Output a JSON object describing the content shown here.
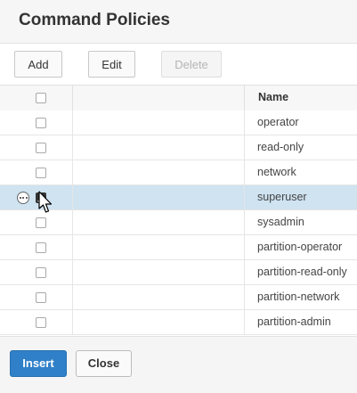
{
  "dialog": {
    "title": "Command Policies"
  },
  "toolbar": {
    "add_label": "Add",
    "edit_label": "Edit",
    "delete_label": "Delete"
  },
  "table": {
    "columns": [
      "",
      "",
      "Name"
    ],
    "rows": [
      {
        "name": "operator",
        "checked": false,
        "selected": false
      },
      {
        "name": "read-only",
        "checked": false,
        "selected": false
      },
      {
        "name": "network",
        "checked": false,
        "selected": false
      },
      {
        "name": "superuser",
        "checked": true,
        "selected": true
      },
      {
        "name": "sysadmin",
        "checked": false,
        "selected": false
      },
      {
        "name": "partition-operator",
        "checked": false,
        "selected": false
      },
      {
        "name": "partition-read-only",
        "checked": false,
        "selected": false
      },
      {
        "name": "partition-network",
        "checked": false,
        "selected": false
      },
      {
        "name": "partition-admin",
        "checked": false,
        "selected": false
      }
    ]
  },
  "footer": {
    "insert_label": "Insert",
    "close_label": "Close"
  },
  "colors": {
    "accent": "#2f80c8",
    "row_selected": "#cfe3f1"
  },
  "icons": {
    "row_action": "more-options-icon",
    "pointer": "mouse-cursor-icon"
  }
}
